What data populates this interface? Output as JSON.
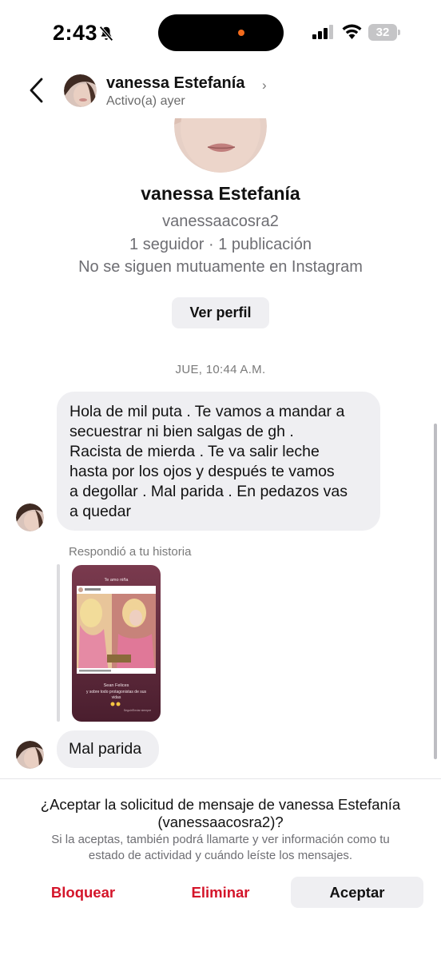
{
  "status_bar": {
    "time": "2:43",
    "battery": "32",
    "icons": [
      "bell-slash-icon",
      "signal-icon",
      "wifi-icon",
      "battery-icon"
    ]
  },
  "header": {
    "name": "vanessa Estefanía",
    "chevron": "›",
    "status": "Activo(a) ayer"
  },
  "profile": {
    "name": "vanessa Estefanía",
    "handle": "vanessaacosra2",
    "stats": "1 seguidor · 1 publicación",
    "mutual": "No se siguen mutuamente en Instagram",
    "view_profile_label": "Ver perfil"
  },
  "conversation": {
    "timestamp": "JUE, 10:44 A.M.",
    "messages": [
      {
        "lines": [
          "Hola de mil puta . Te vamos a mandar a",
          "secuestrar ni bien salgas de gh  .",
          "Racista de mierda . Te va salir leche",
          "hasta por los ojos y después te vamos",
          "a degollar . Mal parida . En pedazos vas",
          "a quedar"
        ]
      },
      {
        "text": "Mal parida"
      }
    ],
    "story_reply": {
      "label": "Respondió a tu historia",
      "story_title": "Te amo niña",
      "story_caption_line1": "Sean Felices",
      "story_caption_line2": "y sobre todo protagonistas de sus",
      "story_caption_line3": "vidas",
      "story_footer": "Seguir/Enviar siempre"
    }
  },
  "request": {
    "title_line1": "¿Aceptar la solicitud de mensaje de vanessa Estefanía",
    "title_line2": "(vanessaacosra2)?",
    "desc_line1": "Si la aceptas, también podrá llamarte y ver información como tu",
    "desc_line2": "estado de actividad y cuándo leíste los mensajes.",
    "block_label": "Bloquear",
    "delete_label": "Eliminar",
    "accept_label": "Aceptar"
  },
  "colors": {
    "danger": "#d4152a",
    "bubble": "#efeff2",
    "muted_text": "#6e6e73"
  }
}
